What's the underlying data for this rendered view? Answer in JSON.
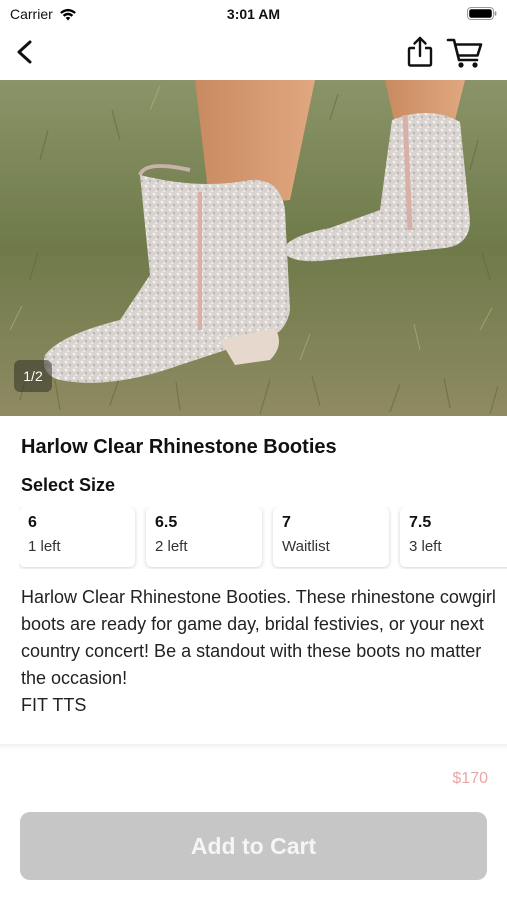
{
  "status_bar": {
    "carrier": "Carrier",
    "time": "3:01 AM"
  },
  "nav": {
    "back_icon": "chevron-left-icon",
    "share_icon": "share-icon",
    "cart_icon": "cart-icon"
  },
  "gallery": {
    "page_indicator": "1/2"
  },
  "product": {
    "title": "Harlow Clear Rhinestone Booties",
    "size_heading": "Select Size",
    "sizes": [
      {
        "size": "6",
        "stock": "1 left"
      },
      {
        "size": "6.5",
        "stock": "2 left"
      },
      {
        "size": "7",
        "stock": "Waitlist"
      },
      {
        "size": "7.5",
        "stock": "3 left"
      }
    ],
    "description": "Harlow Clear Rhinestone Booties. These rhinestone cowgirl boots are ready for game day, bridal festivies, or your next country concert! Be a standout with these boots no matter the occasion!\nFIT TTS",
    "price": "$170"
  },
  "actions": {
    "add_to_cart_label": "Add to Cart"
  },
  "colors": {
    "price": "#e8a6a8",
    "button_disabled": "#c6c6c6"
  }
}
